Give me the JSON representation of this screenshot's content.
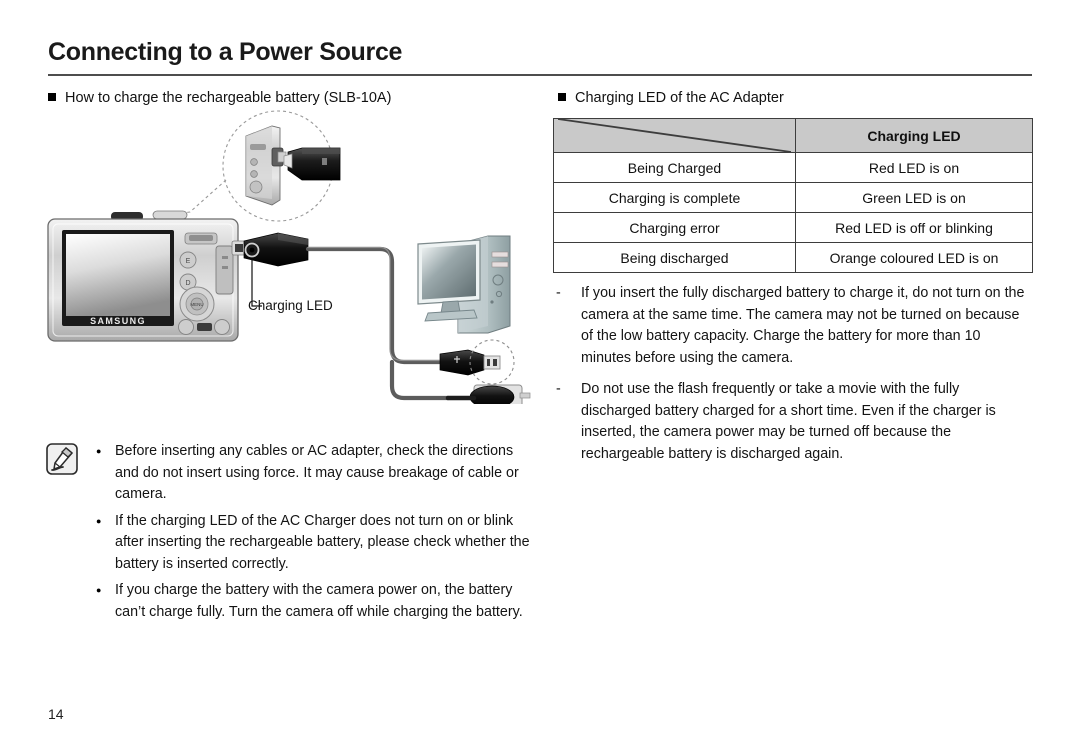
{
  "page": {
    "title": "Connecting to a Power Source",
    "number": "14"
  },
  "sections": {
    "left_heading": "How to charge the rechargeable battery (SLB-10A)",
    "right_heading": "Charging LED of the AC Adapter"
  },
  "diagram": {
    "callout_label": "Charging LED",
    "camera_brand": "SAMSUNG",
    "icons": {
      "camera": "camera-back-icon",
      "battery": "battery-pack-icon",
      "computer": "desktop-computer-icon",
      "usb_port": "usb-port-icon",
      "ac_adapter": "ac-adapter-icon"
    }
  },
  "table": {
    "header": {
      "corner": "",
      "led_column": "Charging LED"
    },
    "columns": [
      "",
      "Charging LED"
    ],
    "rows": [
      {
        "state": "Being Charged",
        "led": "Red LED is on"
      },
      {
        "state": "Charging is complete",
        "led": "Green LED is on"
      },
      {
        "state": "Charging error",
        "led": "Red LED is off or blinking"
      },
      {
        "state": "Being discharged",
        "led": "Orange coloured LED is on"
      }
    ]
  },
  "right_notes": [
    "If you insert the fully discharged battery to charge it, do not turn on the camera at the same time. The camera may not be turned on because of the low battery capacity. Charge the battery for more than 10 minutes before using the camera.",
    "Do not use the flash frequently or take a movie with the fully discharged battery charged for a short time. Even if the charger is inserted, the camera power may be turned off because the rechargeable battery is discharged again."
  ],
  "note_block": {
    "icon": "memo-note-icon",
    "items": [
      "Before inserting any cables or AC adapter, check the directions and do not insert using force. It may cause breakage of cable or camera.",
      "If the charging LED of the AC Charger does not turn on or blink after inserting the rechargeable battery, please check whether the battery is inserted correctly.",
      "If you charge the battery with the camera power on, the battery can’t charge fully. Turn the camera off while charging the battery."
    ]
  },
  "colors": {
    "rule": "#4d4d4d",
    "table_header_bg": "#c9c9c9",
    "table_border": "#3d3d3d",
    "text": "#111111"
  }
}
